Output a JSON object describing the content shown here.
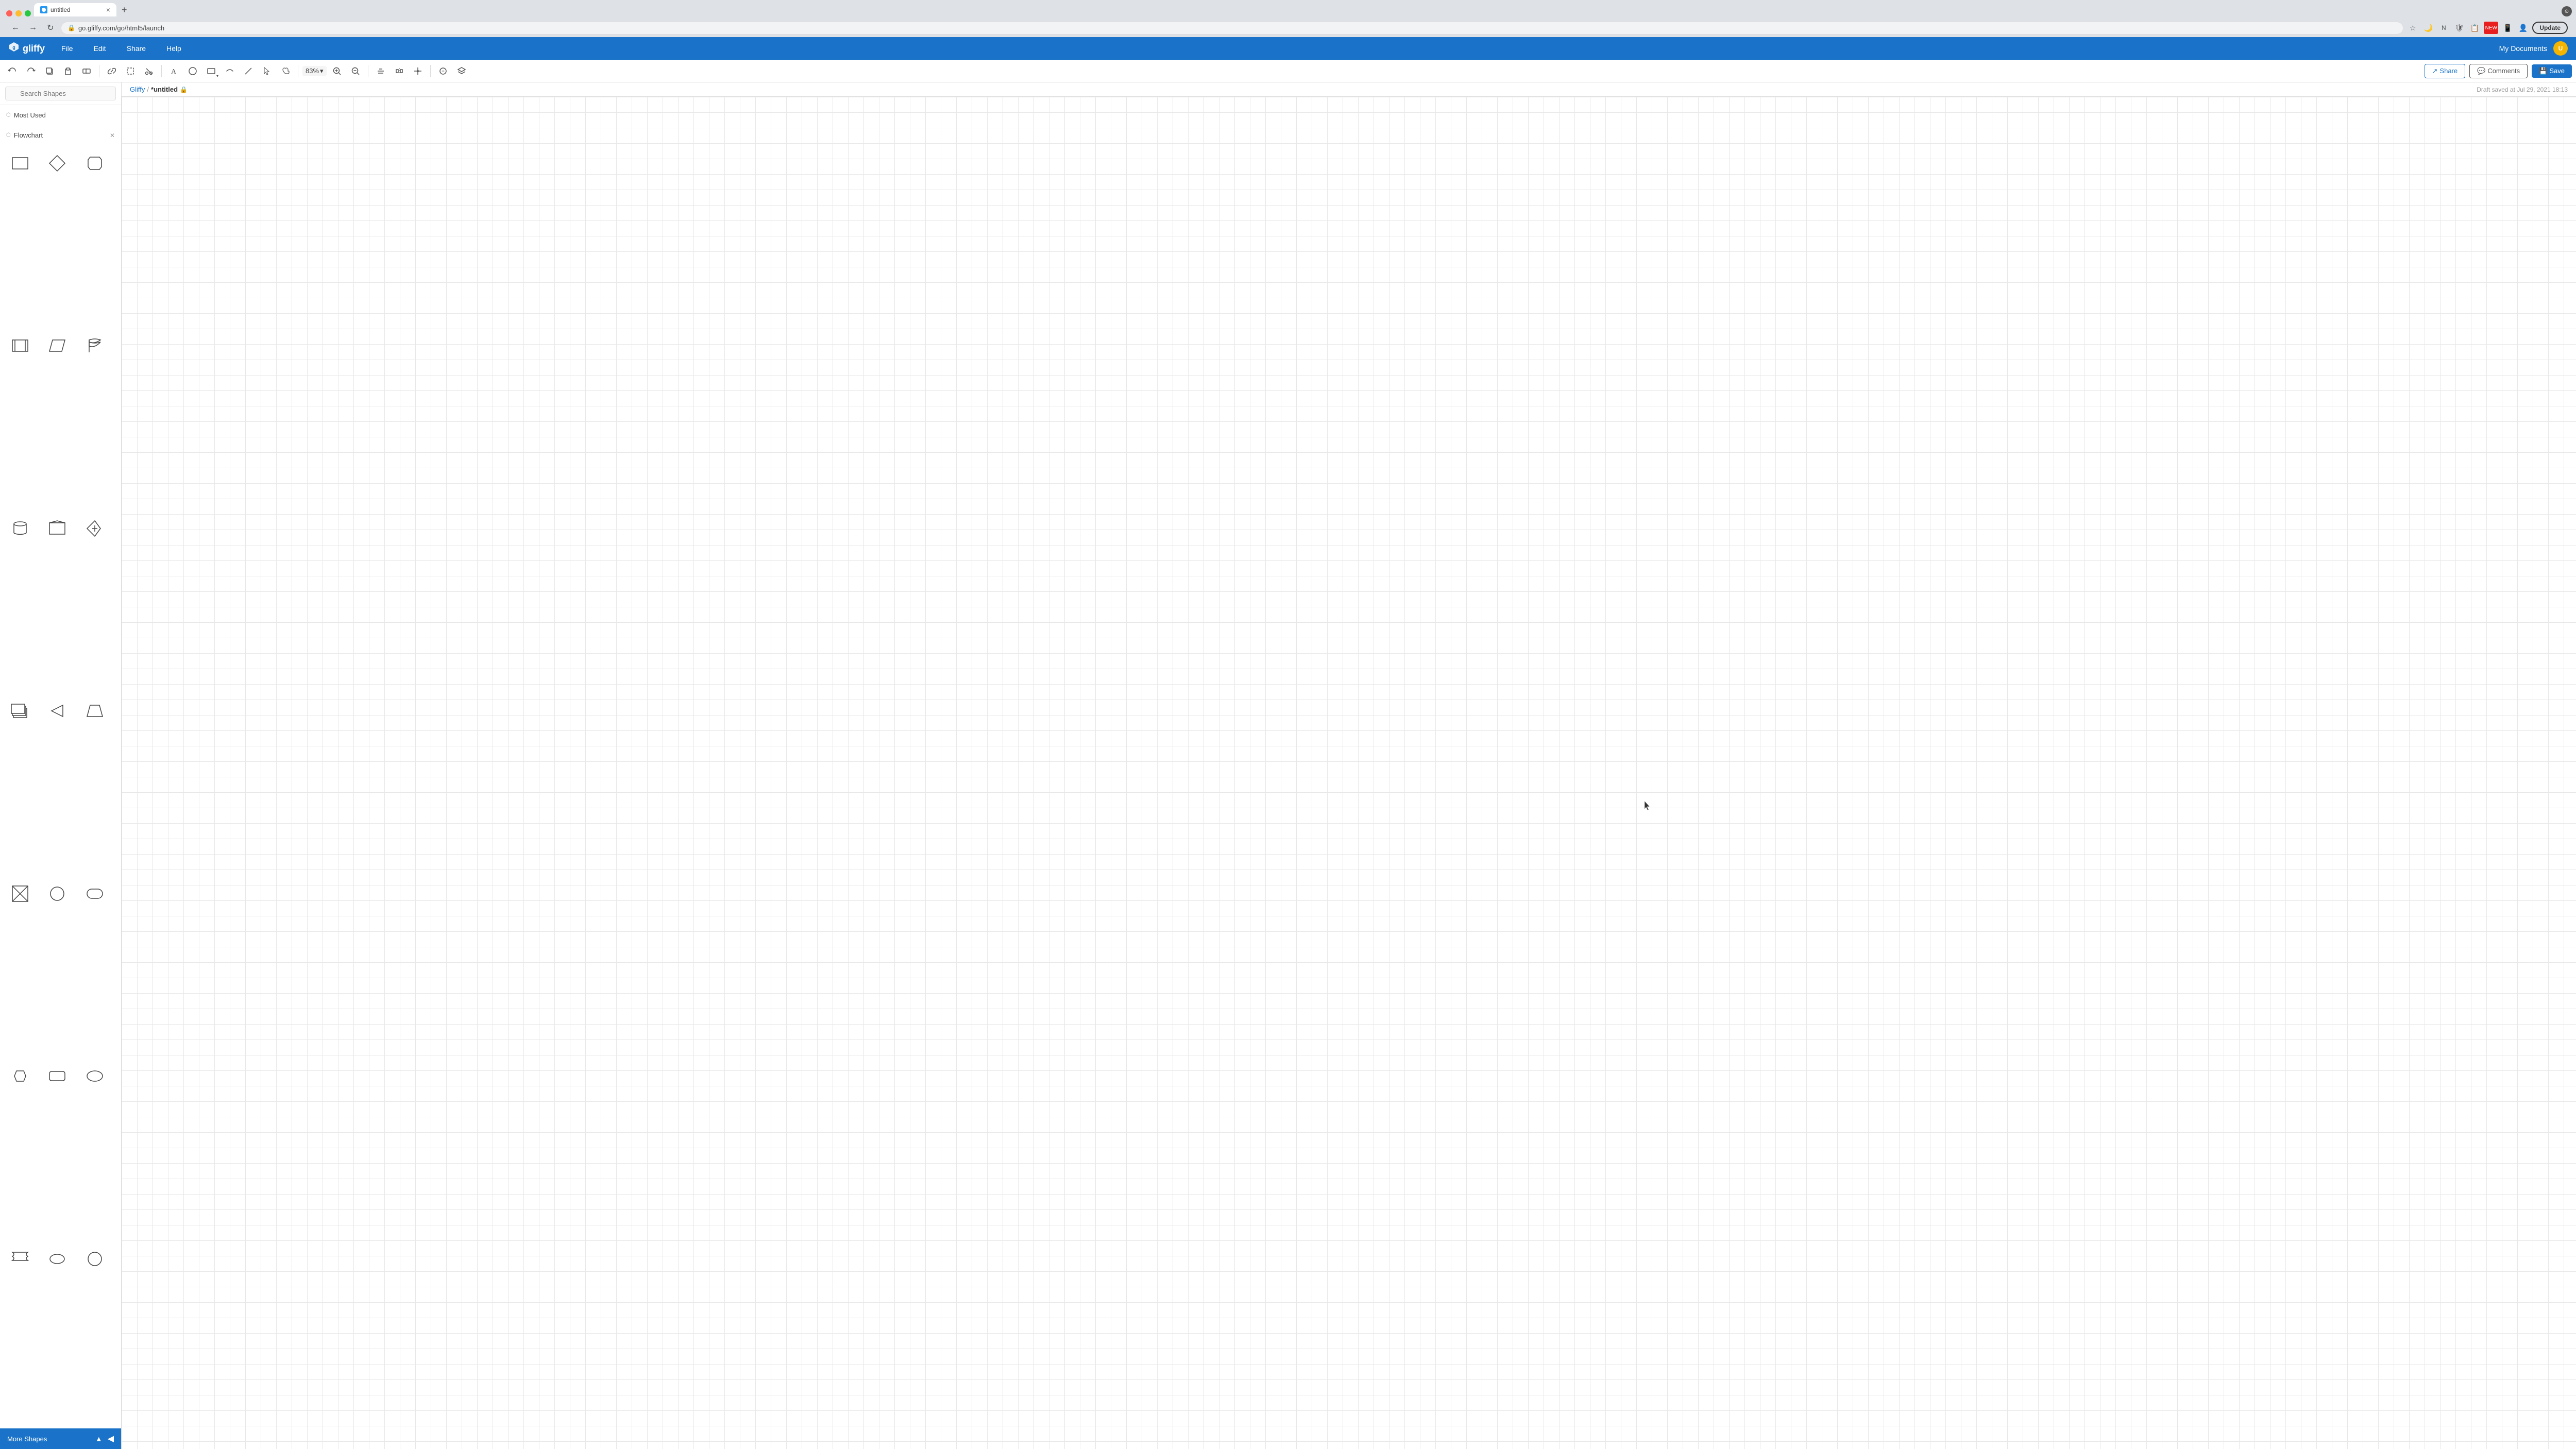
{
  "browser": {
    "tab_title": "untitled",
    "address": "go.gliffy.com/go/html5/launch",
    "new_tab_label": "+",
    "tab_close": "×",
    "update_btn": "Update"
  },
  "menu": {
    "logo": "gliffy",
    "items": [
      "File",
      "Edit",
      "Share",
      "Help"
    ],
    "my_documents": "My Documents"
  },
  "toolbar": {
    "zoom_level": "83%",
    "share_label": "Share",
    "comments_label": "Comments",
    "save_label": "Save"
  },
  "document": {
    "breadcrumb_home": "Gliffy",
    "separator": "/",
    "title": "*untitled",
    "draft_saved": "Draft saved at Jul 29, 2021 18:13"
  },
  "sidebar": {
    "search_placeholder": "Search Shapes",
    "most_used_label": "Most Used",
    "flowchart_label": "Flowchart",
    "more_shapes_label": "More Shapes"
  },
  "shapes": [
    {
      "name": "rectangle",
      "type": "rect"
    },
    {
      "name": "diamond",
      "type": "diamond"
    },
    {
      "name": "display",
      "type": "display"
    },
    {
      "name": "subroutine",
      "type": "subroutine"
    },
    {
      "name": "parallelogram",
      "type": "parallelogram"
    },
    {
      "name": "flag",
      "type": "flag2"
    },
    {
      "name": "cylinder",
      "type": "cylinder"
    },
    {
      "name": "pentagon",
      "type": "pentagon"
    },
    {
      "name": "manual-input",
      "type": "manual-input"
    },
    {
      "name": "stacked",
      "type": "stacked"
    },
    {
      "name": "triangle-left",
      "type": "tri-left"
    },
    {
      "name": "trapezoid-up",
      "type": "trapezoid-up"
    },
    {
      "name": "cross-rect",
      "type": "cross-rect"
    },
    {
      "name": "circle",
      "type": "circle"
    },
    {
      "name": "rounded-rect",
      "type": "rounded-rect"
    },
    {
      "name": "hexagon",
      "type": "hexagon"
    },
    {
      "name": "rect-rounded2",
      "type": "rect-rounded2"
    },
    {
      "name": "stadium",
      "type": "stadium"
    },
    {
      "name": "tape",
      "type": "tape"
    },
    {
      "name": "oval",
      "type": "oval"
    },
    {
      "name": "circle2",
      "type": "circle2"
    }
  ]
}
